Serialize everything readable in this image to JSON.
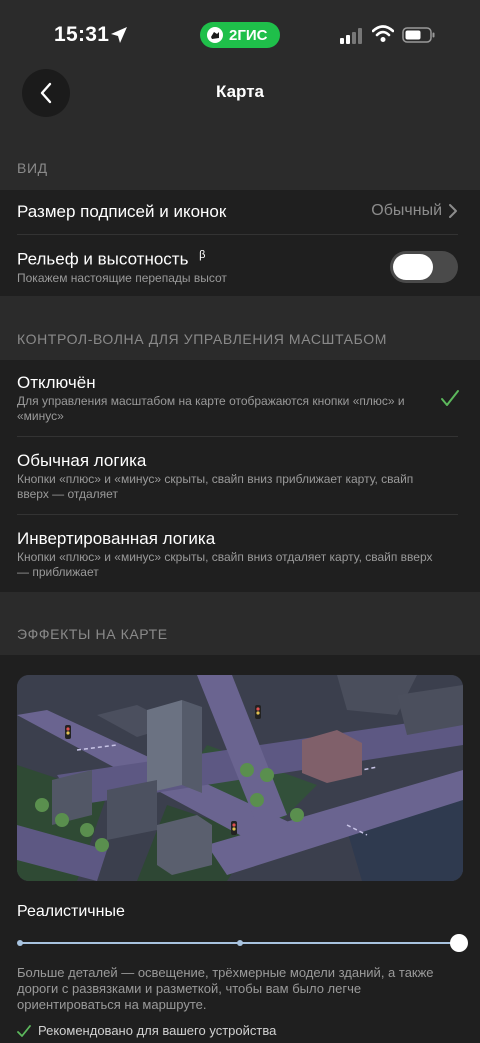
{
  "status_bar": {
    "time": "15:31",
    "app_badge": "2ГИС",
    "icons": [
      "location-arrow-icon",
      "cellular-signal-icon",
      "wifi-icon",
      "battery-icon"
    ]
  },
  "nav": {
    "title": "Карта",
    "back_icon": "chevron-left-icon"
  },
  "sections": {
    "view": {
      "header": "ВИД",
      "label_size": {
        "title": "Размер подписей и иконок",
        "value": "Обычный"
      },
      "relief": {
        "title": "Рельеф и высотность",
        "badge": "β",
        "subtitle": "Покажем настоящие перепады высот",
        "enabled": true
      }
    },
    "zoom_control": {
      "header": "КОНТРОЛ-ВОЛНА ДЛЯ УПРАВЛЕНИЯ МАСШТАБОМ",
      "options": [
        {
          "title": "Отключён",
          "subtitle": "Для управления масштабом на карте отображаются кнопки «плюс» и «минус»",
          "selected": true
        },
        {
          "title": "Обычная логика",
          "subtitle": "Кнопки «плюс» и «минус» скрыты, свайп вниз приближает карту, свайп вверх — отдаляет",
          "selected": false
        },
        {
          "title": "Инвертированная логика",
          "subtitle": "Кнопки «плюс» и «минус» скрыты, свайп вниз отдаляет карту, свайп вверх — приближает",
          "selected": false
        }
      ]
    },
    "effects": {
      "header": "ЭФФЕКТЫ НА КАРТЕ",
      "level_label": "Реалистичные",
      "slider": {
        "steps": 3,
        "selected_step": 3
      },
      "description": "Больше деталей — освещение, трёхмерные модели зданий, а также дороги с развязками и разметкой, чтобы вам было легче ориентироваться на маршруте.",
      "recommended": "Рекомендовано для вашего устройства"
    }
  },
  "colors": {
    "background": "#2b2b2b",
    "group": "#1f1f1f",
    "accent_green": "#5cb85c",
    "badge_green": "#1fbf4a",
    "slider": "#a8c3df"
  }
}
